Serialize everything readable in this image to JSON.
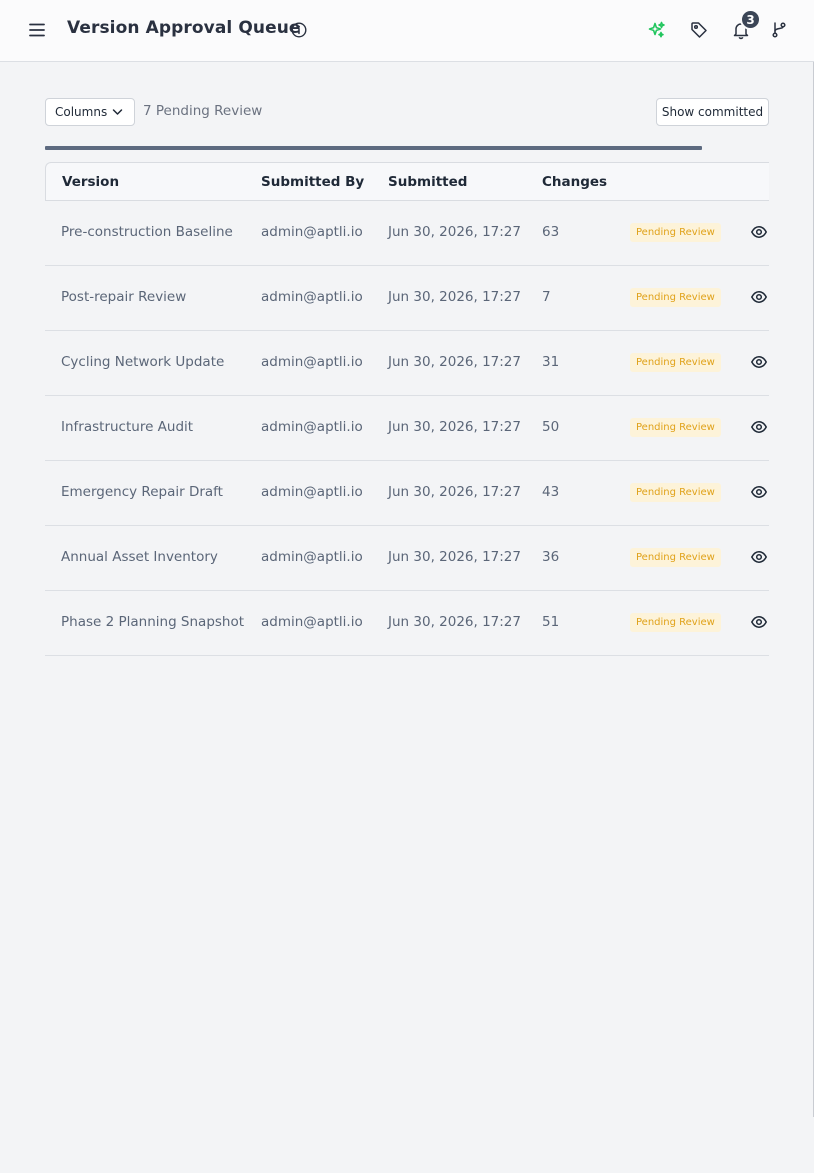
{
  "header": {
    "title": "Version Approval Queue",
    "notification_count": "3",
    "icons": [
      "menu-icon",
      "info-icon",
      "sparkle-icon",
      "tag-icon",
      "bell-icon",
      "branch-icon"
    ],
    "sparkle_color": "#22c55e"
  },
  "toolbar": {
    "columns_label": "Columns",
    "pending_count_label": "7 Pending Review",
    "show_committed_label": "Show committed"
  },
  "table": {
    "columns": [
      "Version",
      "Submitted By",
      "Submitted",
      "Changes"
    ],
    "rows": [
      {
        "version": "Pre-construction Baseline",
        "submitted_by": "admin@aptli.io",
        "submitted": "Jun 30, 2026, 17:27",
        "changes": "63",
        "status": "Pending Review"
      },
      {
        "version": "Post-repair Review",
        "submitted_by": "admin@aptli.io",
        "submitted": "Jun 30, 2026, 17:27",
        "changes": "7",
        "status": "Pending Review"
      },
      {
        "version": "Cycling Network Update",
        "submitted_by": "admin@aptli.io",
        "submitted": "Jun 30, 2026, 17:27",
        "changes": "31",
        "status": "Pending Review"
      },
      {
        "version": "Infrastructure Audit",
        "submitted_by": "admin@aptli.io",
        "submitted": "Jun 30, 2026, 17:27",
        "changes": "50",
        "status": "Pending Review"
      },
      {
        "version": "Emergency Repair Draft",
        "submitted_by": "admin@aptli.io",
        "submitted": "Jun 30, 2026, 17:27",
        "changes": "43",
        "status": "Pending Review"
      },
      {
        "version": "Annual Asset Inventory",
        "submitted_by": "admin@aptli.io",
        "submitted": "Jun 30, 2026, 17:27",
        "changes": "36",
        "status": "Pending Review"
      },
      {
        "version": "Phase 2 Planning Snapshot",
        "submitted_by": "admin@aptli.io",
        "submitted": "Jun 30, 2026, 17:27",
        "changes": "51",
        "status": "Pending Review"
      }
    ]
  },
  "colors": {
    "status_text": "#e0a21a",
    "status_bg": "#fdf3d9",
    "badge_bg": "#3b4556"
  }
}
